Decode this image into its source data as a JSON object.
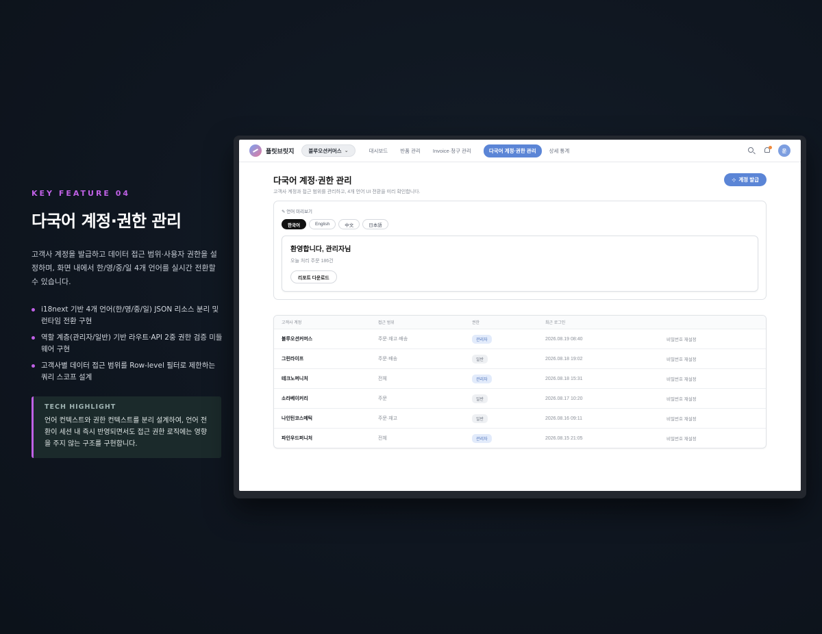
{
  "feature": {
    "kicker": "KEY FEATURE 04",
    "title": "다국어 계정·권한 관리",
    "description": "고객사 계정을 발급하고 데이터 접근 범위·사용자 권한을 설정하며, 화면 내에서 한/영/중/일 4개 언어를 실시간 전환할 수 있습니다.",
    "bullets": [
      "i18next 기반 4개 언어(한/영/중/일) JSON 리소스 분리 및 런타임 전환 구현",
      "역할 계층(관리자/일반) 기반 라우트·API 2중 권한 검증 미들웨어 구현",
      "고객사별 데이터 접근 범위를 Row-level 필터로 제한하는 쿼리 스코프 설계"
    ],
    "highlight": {
      "label": "TECH HIGHLIGHT",
      "text": "언어 컨텍스트와 권한 컨텍스트를 분리 설계하여, 언어 전환이 세션 내 즉시 반영되면서도 접근 권한 로직에는 영향을 주지 않는 구조를 구현합니다."
    }
  },
  "app": {
    "brand": "플릿브릿지",
    "client_select": "블루오션커머스",
    "nav": [
      "대시보드",
      "반품 관리",
      "Invoice·청구 관리",
      "다국어 계정·권한 관리",
      "상세 통계"
    ],
    "nav_active_index": 3,
    "avatar_initial": "운",
    "page_title": "다국어 계정·권한 관리",
    "page_subtitle": "고객사 계정과 접근 범위를 관리하고, 4개 언어 UI 전환을 미리 확인합니다.",
    "primary_button": "계정 발급",
    "preview": {
      "label": "언어 미리보기",
      "languages": [
        "한국어",
        "English",
        "中文",
        "日本語"
      ],
      "active_language": "한국어",
      "welcome_title": "환영합니다, 관리자님",
      "welcome_sub": "오늘 처리 주문 186건",
      "report_button": "리포트 다운로드"
    },
    "table": {
      "headers": [
        "고객사 계정",
        "접근 범위",
        "권한",
        "최근 로그인",
        ""
      ],
      "rows": [
        {
          "name": "블루오션커머스",
          "scope": "주문·재고·배송",
          "role": "관리자",
          "role_type": "admin",
          "last_login": "2026.08.19 08:40",
          "action": "비밀번호 재설정"
        },
        {
          "name": "그린라이프",
          "scope": "주문·배송",
          "role": "일반",
          "role_type": "general",
          "last_login": "2026.08.18 19:02",
          "action": "비밀번호 재설정"
        },
        {
          "name": "테크노퍼니처",
          "scope": "전체",
          "role": "관리자",
          "role_type": "admin",
          "last_login": "2026.08.18 15:31",
          "action": "비밀번호 재설정"
        },
        {
          "name": "소라베이커리",
          "scope": "주문",
          "role": "일반",
          "role_type": "general",
          "last_login": "2026.08.17 10:20",
          "action": "비밀번호 재설정"
        },
        {
          "name": "나인틴코스메틱",
          "scope": "주문·재고",
          "role": "일반",
          "role_type": "general",
          "last_login": "2026.08.16 09:11",
          "action": "비밀번호 재설정"
        },
        {
          "name": "파인우드퍼니처",
          "scope": "전체",
          "role": "관리자",
          "role_type": "admin",
          "last_login": "2026.08.15 21:05",
          "action": "비밀번호 재설정"
        }
      ]
    }
  },
  "colors": {
    "accent_purple": "#c061e6",
    "primary_blue": "#5b85d6",
    "background": "#0f1620"
  }
}
